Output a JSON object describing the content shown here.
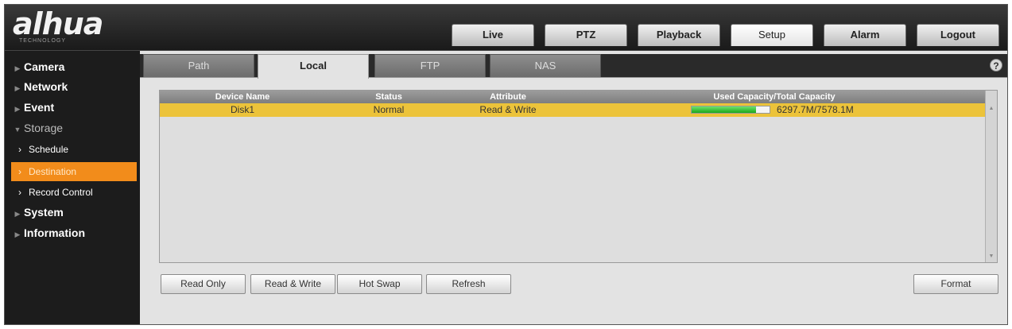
{
  "header": {
    "logo_text": "alhua",
    "logo_subtext": "TECHNOLOGY",
    "tabs": [
      {
        "label": "Live"
      },
      {
        "label": "PTZ"
      },
      {
        "label": "Playback"
      },
      {
        "label": "Setup"
      },
      {
        "label": "Alarm"
      },
      {
        "label": "Logout"
      }
    ],
    "active_tab": "Setup"
  },
  "sidebar": {
    "items": [
      {
        "label": "Camera"
      },
      {
        "label": "Network"
      },
      {
        "label": "Event"
      },
      {
        "label": "Storage"
      },
      {
        "label": "Schedule"
      },
      {
        "label": "Destination"
      },
      {
        "label": "Record Control"
      },
      {
        "label": "System"
      },
      {
        "label": "Information"
      }
    ],
    "active_item": "Destination"
  },
  "content": {
    "sub_tabs": [
      {
        "label": "Path"
      },
      {
        "label": "Local"
      },
      {
        "label": "FTP"
      },
      {
        "label": "NAS"
      }
    ],
    "active_sub_tab": "Local",
    "help_glyph": "?",
    "table": {
      "columns": [
        "Device Name",
        "Status",
        "Attribute",
        "Used Capacity/Total Capacity"
      ],
      "rows": [
        {
          "device_name": "Disk1",
          "status": "Normal",
          "attribute": "Read & Write",
          "capacity_text": "6297.7M/7578.1M",
          "capacity_used_fraction": 0.83
        }
      ]
    },
    "buttons": {
      "read_only": "Read Only",
      "read_write": "Read & Write",
      "hot_swap": "Hot Swap",
      "refresh": "Refresh",
      "format": "Format"
    }
  },
  "colors": {
    "active_sidebar": "#f28c1b",
    "selected_row": "#ecc33a",
    "capacity_fill": "#1aa81a"
  }
}
